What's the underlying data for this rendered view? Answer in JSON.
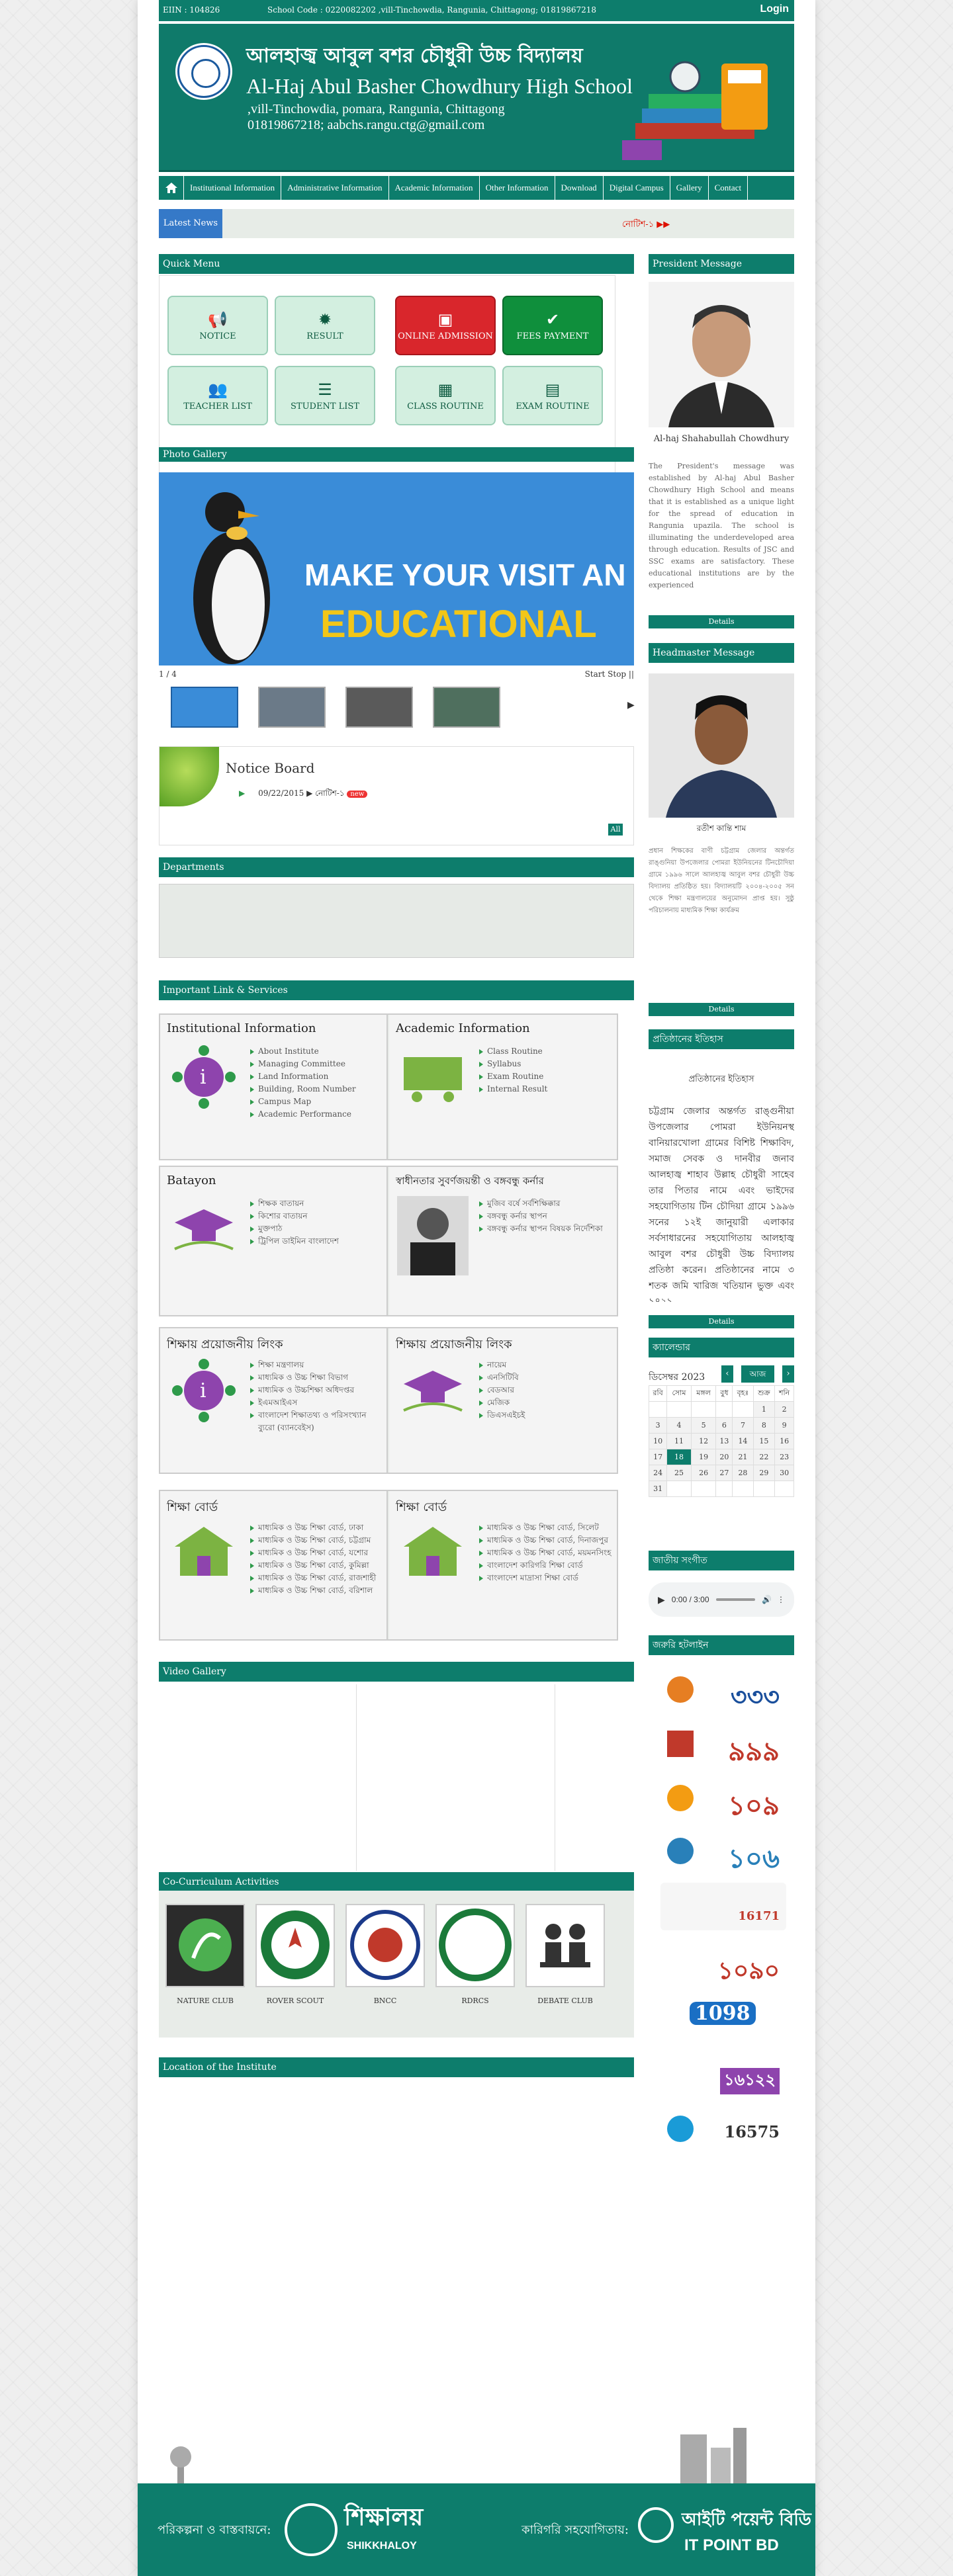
{
  "topbar": {
    "eiin": "EIIN : 104826",
    "info": "School Code : 0220082202 ,vill-Tinchowdia, Rangunia, Chittagong; 01819867218",
    "login": "Login"
  },
  "banner": {
    "name_bn": "আলহাজ্ব আবুল বশর চৌধুরী উচ্চ বিদ্যালয়",
    "name_en": "Al-Haj Abul Basher Chowdhury High School",
    "address": ",vill-Tinchowdia, pomara, Rangunia, Chittagong",
    "contact": "01819867218; aabchs.rangu.ctg@gmail.com"
  },
  "menu": [
    "Institutional Information",
    "Administrative Information",
    "Academic Information",
    "Other Information",
    "Download",
    "Digital Campus",
    "Gallery",
    "Contact"
  ],
  "latest": {
    "label": "Latest News",
    "ticker": "নোটিশ-১"
  },
  "quick_menu": {
    "title": "Quick Menu",
    "buttons": [
      {
        "label": "NOTICE",
        "icon": "megaphone-icon"
      },
      {
        "label": "RESULT",
        "icon": "gear-icon"
      },
      {
        "label": "ONLINE ADMISSION",
        "icon": "id-card-icon"
      },
      {
        "label": "FEES PAYMENT",
        "icon": "check-circle-icon"
      },
      {
        "label": "TEACHER LIST",
        "icon": "users-icon"
      },
      {
        "label": "STUDENT LIST",
        "icon": "list-icon"
      },
      {
        "label": "CLASS ROUTINE",
        "icon": "calendar-icon"
      },
      {
        "label": "EXAM ROUTINE",
        "icon": "card-icon"
      }
    ]
  },
  "photo_gallery": {
    "title": "Photo Gallery",
    "slide_line1": "MAKE YOUR VISIT AN",
    "slide_line2": "EDUCATIONAL",
    "counter": "1 / 4",
    "stop": "Start Stop ||"
  },
  "notice_board": {
    "title": "Notice Board",
    "date": "09/22/2015",
    "item": "নোটিশ-১",
    "new": "new",
    "all": "All"
  },
  "departments": {
    "title": "Departments"
  },
  "links": {
    "title": "Important Link & Services",
    "cells": [
      {
        "title": "Institutional Information",
        "items": [
          "About Institute",
          "Managing Committee",
          "Land Information",
          "Building, Room Number",
          "Campus Map",
          "Academic Performance"
        ]
      },
      {
        "title": "Academic Information",
        "items": [
          "Class Routine",
          "Syllabus",
          "Exam Routine",
          "Internal Result"
        ]
      },
      {
        "title": "Batayon",
        "items": [
          "শিক্ষক বাতায়ন",
          "কিশোর বাতায়ন",
          "মুক্তপাঠ",
          "ট্রিপিল ডাইমিন বাংলাদেশ"
        ]
      },
      {
        "title": "স্বাধীনতার সুবর্ণজয়ন্তী ও বঙ্গবন্ধু কর্নার",
        "items": [
          "মুজিব বর্ষে সর্বশিক্ষিক্কার",
          "বঙ্গবন্ধু কর্নার স্থাপন",
          "বঙ্গবন্ধু কর্নার স্থাপন বিষয়ক নির্দেশিকা"
        ]
      },
      {
        "title": "শিক্ষায় প্রয়োজনীয় লিংক",
        "items": [
          "শিক্ষা মন্ত্রণালয়",
          "মাধ্যমিক ও উচ্চ শিক্ষা বিভাগ",
          "মাধ্যমিক ও উচ্চশিক্ষা অধিদপ্তর",
          "ইএমআইএস",
          "বাংলাদেশ শিক্ষাতথ্য ও পরিসংখ্যান ব্যুরো (ব্যানবেইস)"
        ]
      },
      {
        "title": "শিক্ষায় প্রয়োজনীয় লিংক",
        "items": [
          "নায়েম",
          "এনসিটিবি",
          "বেডআর",
          "মেজিক",
          "ডিএসএইচই"
        ]
      },
      {
        "title": "শিক্ষা বোর্ড",
        "items": [
          "মাধ্যমিক ও উচ্চ শিক্ষা বোর্ড, ঢাকা",
          "মাধ্যমিক ও উচ্চ শিক্ষা বোর্ড, চট্টগ্রাম",
          "মাধ্যমিক ও উচ্চ শিক্ষা বোর্ড, যশোর",
          "মাধ্যমিক ও উচ্চ শিক্ষা বোর্ড, কুমিল্লা",
          "মাধ্যমিক ও উচ্চ শিক্ষা বোর্ড, রাজশাহী",
          "মাধ্যমিক ও উচ্চ শিক্ষা বোর্ড, বরিশাল"
        ]
      },
      {
        "title": "শিক্ষা বোর্ড",
        "items": [
          "মাধ্যমিক ও উচ্চ শিক্ষা বোর্ড, সিলেট",
          "মাধ্যমিক ও উচ্চ শিক্ষা বোর্ড, দিনাজপুর",
          "মাধ্যমিক ও উচ্চ শিক্ষা বোর্ড, ময়মনসিংহ",
          "বাংলাদেশ কারিগরি শিক্ষা বোর্ড",
          "বাংলাদেশ মাদ্রাসা শিক্ষা বোর্ড"
        ]
      }
    ]
  },
  "video_gallery": {
    "title": "Video Gallery"
  },
  "cca": {
    "title": "Co-Curriculum Activities",
    "clubs": [
      "NATURE CLUB",
      "ROVER SCOUT",
      "BNCC",
      "RDRCS",
      "DEBATE CLUB"
    ]
  },
  "location": {
    "title": "Location of the Institute"
  },
  "president": {
    "title": "President Message",
    "name": "Al-haj Shahabullah Chowdhury",
    "text": "The President's message was established by Al-haj Abul Basher Chowdhury High School and means that it is established as a unique light for the spread of education in Rangunia upazila. The school is illuminating the underdeveloped area through education. Results of JSC and SSC exams are satisfactory. These educational institutions are by the experienced",
    "details": "Details"
  },
  "headmaster": {
    "title": "Headmaster Message",
    "name": "রতীশ কান্তি শাম",
    "text": "প্রধান শিক্ষকের বাণী চট্টগ্রাম জেলার অন্তর্গত রাঙ্গুনিয়া উপজেলার পোমরা ইউনিয়নের টিনচৌদিয়া গ্রামে ১৯৯৬ সালে আলহাজ্ব আবুল বশর চৌধুরী উচ্চ বিদ্যালয় প্রতিষ্ঠিত হয়। বিদ্যালয়টি ২০০৪-২০০৫ সন থেকে শিক্ষা মন্ত্রণালয়ের অনুমোদন প্রাপ্ত হয়। সুষ্ঠু পরিচালনায় মাধ্যমিক শিক্ষা কার্যক্রম",
    "details": "Details"
  },
  "history": {
    "title": "প্রতিষ্ঠানের ইতিহাস",
    "subtitle": "প্রতিষ্ঠানের ইতিহাস",
    "text": "চট্টগ্রাম জেলার অন্তর্গত রাঙ্গুনীয়া উপজেলার পোমরা ইউনিয়নস্থ বানিয়ারখোলা গ্রামের বিশিষ্ট শিক্ষাবিদ, সমাজ সেবক ও দানবীর জনাব আলহাজ্ব শাহাব উল্লাহ চৌধুরী সাহেব তার পিতার নামে এবং ভাইদের সহযোগিতায় টিন চৌদিয়া গ্রামে ১৯৯৬ সনের ১২ই জানুয়ারী এলাকার সর্বসাধারনের সহযোগিতায় আলহাজ্ব আবুল বশর চৌধুরী উচ্চ বিদ্যালয় প্রতিষ্ঠা করেন। প্রতিষ্ঠানের নামে ৩ শতক জমি খারিজ খতিয়ান ভুক্ত এবং ১৪২১",
    "details": "Details"
  },
  "calendar": {
    "title": "ক্যালেন্ডার",
    "month": "ডিসেম্বর 2023",
    "today": "আজ",
    "days": [
      "রবি",
      "সোম",
      "মঙ্গল",
      "বুধ",
      "বৃহঃ",
      "শুক্র",
      "শনি"
    ],
    "weeks": [
      [
        "",
        "",
        "",
        "",
        "",
        "1",
        "2"
      ],
      [
        "3",
        "4",
        "5",
        "6",
        "7",
        "8",
        "9"
      ],
      [
        "10",
        "11",
        "12",
        "13",
        "14",
        "15",
        "16"
      ],
      [
        "17",
        "18",
        "19",
        "20",
        "21",
        "22",
        "23"
      ],
      [
        "24",
        "25",
        "26",
        "27",
        "28",
        "29",
        "30"
      ],
      [
        "31",
        "",
        "",
        "",
        "",
        "",
        ""
      ]
    ],
    "highlight": "18"
  },
  "anthem": {
    "title": "জাতীয় সংগীত",
    "time": "0:00 / 3:00"
  },
  "hotline": {
    "title": "জরুরি হটলাইন",
    "numbers": [
      "৩৩৩",
      "৯৯৯",
      "১০৯",
      "১০৬",
      "16171",
      "১০৯০",
      "1098",
      "১৬১২২",
      "16575"
    ]
  },
  "footer": {
    "left": "পরিকল্পনা ও বাস্তবায়নে:",
    "brand1": "শিক্ষালয়",
    "brand1_en": "SHIKKHALOY",
    "right": "কারিগরি সহযোগিতায়:",
    "brand2": "আইটি পয়েন্ট বিডি",
    "brand2_en": "IT POINT BD"
  }
}
